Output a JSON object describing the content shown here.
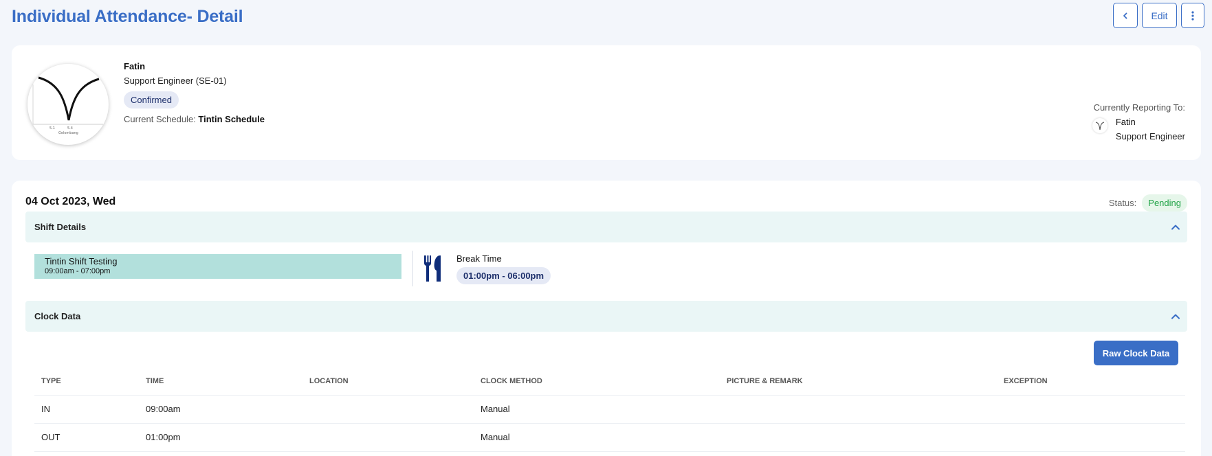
{
  "page": {
    "title": "Individual Attendance- Detail"
  },
  "toolbar": {
    "back_icon": "chevron-left-icon",
    "edit_label": "Edit",
    "more_icon": "vertical-ellipsis-icon"
  },
  "employee": {
    "name": "Fatin",
    "role": "Support Engineer (SE-01)",
    "employment_status": "Confirmed",
    "schedule_label": "Current Schedule:",
    "schedule_name": "Tintin Schedule"
  },
  "reporting": {
    "label": "Currently Reporting To:",
    "name": "Fatin",
    "title": "Support Engineer"
  },
  "attendance": {
    "date": "04 Oct 2023, Wed",
    "status_label": "Status:",
    "status": "Pending",
    "colors": {
      "pending": "#22a447",
      "accent": "#3a6ec6",
      "shift_block": "#b2e0dc"
    }
  },
  "shift_details": {
    "section_title": "Shift Details",
    "shift_name": "Tintin Shift Testing",
    "shift_time": "09:00am - 07:00pm",
    "break_label": "Break Time",
    "break_time": "01:00pm - 06:00pm",
    "break_icon": "fork-knife-icon"
  },
  "clock_data": {
    "section_title": "Clock Data",
    "raw_button": "Raw Clock Data",
    "columns": [
      "TYPE",
      "TIME",
      "LOCATION",
      "CLOCK METHOD",
      "PICTURE & REMARK",
      "EXCEPTION"
    ],
    "rows": [
      {
        "type": "IN",
        "time": "09:00am",
        "location": "",
        "method": "Manual",
        "remark": "",
        "exception": ""
      },
      {
        "type": "OUT",
        "time": "01:00pm",
        "location": "",
        "method": "Manual",
        "remark": "",
        "exception": ""
      }
    ]
  }
}
